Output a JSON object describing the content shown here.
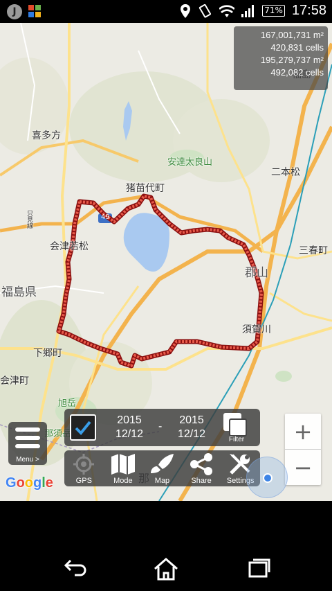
{
  "status_bar": {
    "app_icon_label": "J",
    "battery": "71%",
    "time": "17:58"
  },
  "stats": {
    "area1": "167,001,731 m²",
    "cells1": "420,831 cells",
    "area2": "195,279,737 m²",
    "cells2": "492,082 cells"
  },
  "map_labels": {
    "kitakata": "喜多方",
    "adatara": "安達太良山",
    "inawashiro": "猪苗代町",
    "nihonmatsu": "二本松",
    "aizuwakamatsu": "会津若松",
    "route49": "49",
    "fukushima_pref": "福島県",
    "miharu": "三春町",
    "koriyama": "郡山",
    "sukagawa": "須賀川",
    "shimogo": "下郷町",
    "minamiaizu": "会津町",
    "asahidake": "旭岳",
    "nasu": "那須岳",
    "fukushima_city": "福島",
    "nasu_town": "那",
    "tajima": "只見線"
  },
  "menu": {
    "label": "Menu >"
  },
  "filter": {
    "checked": true,
    "from_year": "2015",
    "from_date": "12/12",
    "separator": "-",
    "to_year": "2015",
    "to_date": "12/12",
    "filter_label": "Filter"
  },
  "toolbar": {
    "gps_label": "GPS",
    "mode_label": "Mode",
    "map_label": "Map",
    "share_label": "Share",
    "settings_label": "Settings"
  },
  "zoom": {
    "in": "+",
    "out": "−"
  },
  "google_logo": [
    "G",
    "o",
    "o",
    "g",
    "l",
    "e"
  ]
}
